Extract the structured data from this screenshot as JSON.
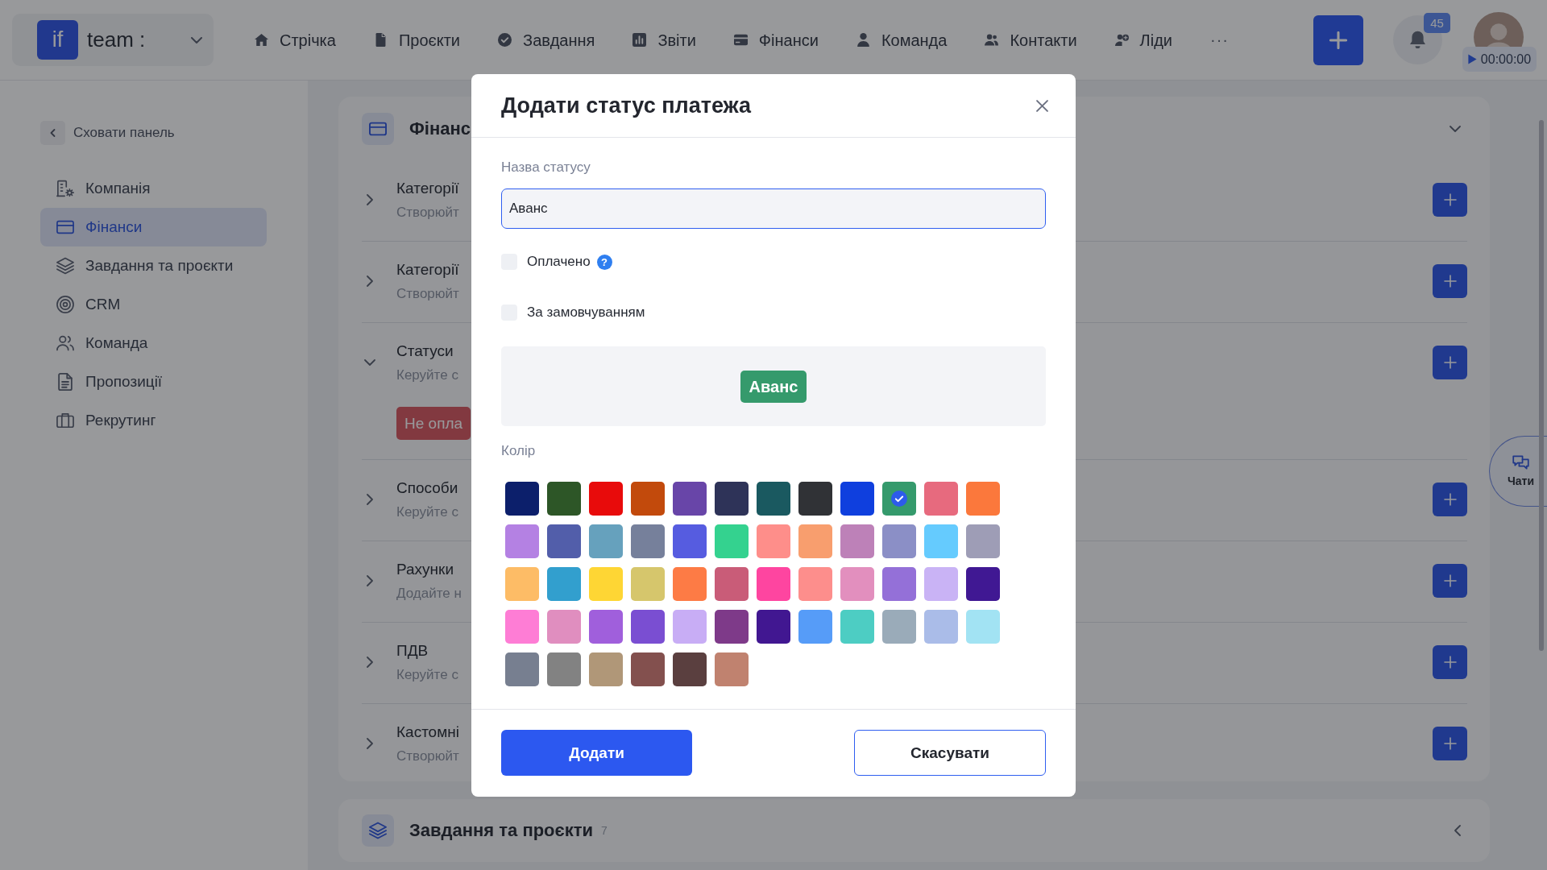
{
  "top_bar": {
    "logo_mark": "if",
    "workspace": "team :",
    "nav": [
      "Стрічка",
      "Проєкти",
      "Завдання",
      "Звіти",
      "Фінанси",
      "Команда",
      "Контакти",
      "Ліди"
    ],
    "more": "···",
    "notifications": "45",
    "timer": "00:00:00"
  },
  "sidebar": {
    "collapse_label": "Сховати панель",
    "items": [
      {
        "label": "Компанія",
        "selected": false
      },
      {
        "label": "Фінанси",
        "selected": true
      },
      {
        "label": "Завдання та проєкти",
        "selected": false
      },
      {
        "label": "CRM",
        "selected": false
      },
      {
        "label": "Команда",
        "selected": false
      },
      {
        "label": "Пропозиції",
        "selected": false
      },
      {
        "label": "Рекрутинг",
        "selected": false
      }
    ]
  },
  "cards": [
    {
      "title": "Фінанс",
      "expanded": true,
      "sections": [
        {
          "title": "Категорії",
          "subtitle": "Створюйт",
          "expanded": false
        },
        {
          "title": "Категорії",
          "subtitle": "Створюйт",
          "expanded": false
        },
        {
          "title": "Статуси",
          "subtitle": "Керуйте с",
          "expanded": true,
          "badges": [
            "Не опла"
          ]
        },
        {
          "title": "Способи",
          "subtitle": "Керуйте с",
          "expanded": false
        },
        {
          "title": "Рахунки",
          "subtitle": "Додайте н",
          "expanded": false
        },
        {
          "title": "ПДВ",
          "subtitle": "Керуйте с",
          "expanded": false
        },
        {
          "title": "Кастомні",
          "subtitle": "Створюйт",
          "expanded": false
        }
      ]
    },
    {
      "title": "Завдання та проєкти",
      "count": "7",
      "expanded": false
    }
  ],
  "chat_tab": {
    "label": "Чати"
  },
  "modal": {
    "title": "Додати статус платежа",
    "name_label": "Назва статусу",
    "name_value": "Аванс",
    "checkboxes": [
      {
        "label": "Оплачено",
        "checked": false,
        "help": "?"
      },
      {
        "label": "За замовчуванням",
        "checked": false
      }
    ],
    "preview": "Аванс",
    "color_label": "Колір",
    "colors": [
      {
        "color": "#0c1f6b",
        "selected": false
      },
      {
        "color": "#2d5627",
        "selected": false
      },
      {
        "color": "#e80b0b",
        "selected": false
      },
      {
        "color": "#c24a0c",
        "selected": false
      },
      {
        "color": "#6845a8",
        "selected": false
      },
      {
        "color": "#2e3358",
        "selected": false
      },
      {
        "color": "#1a5960",
        "selected": false
      },
      {
        "color": "#303236",
        "selected": false
      },
      {
        "color": "#0f3fde",
        "selected": false
      },
      {
        "color": "#359a6c",
        "selected": true
      },
      {
        "color": "#e76a7e",
        "selected": false
      },
      {
        "color": "#fb783c",
        "selected": false
      },
      {
        "color": "#b481e3",
        "selected": false
      },
      {
        "color": "#525eaa",
        "selected": false
      },
      {
        "color": "#66a1bd",
        "selected": false
      },
      {
        "color": "#76809b",
        "selected": false
      },
      {
        "color": "#565ce0",
        "selected": false
      },
      {
        "color": "#34d28f",
        "selected": false
      },
      {
        "color": "#fe8e8a",
        "selected": false
      },
      {
        "color": "#f89e6e",
        "selected": false
      },
      {
        "color": "#bd81b8",
        "selected": false
      },
      {
        "color": "#8b8fc6",
        "selected": false
      },
      {
        "color": "#65cbfe",
        "selected": false
      },
      {
        "color": "#9e9db6",
        "selected": false
      },
      {
        "color": "#fdbc66",
        "selected": false
      },
      {
        "color": "#329fce",
        "selected": false
      },
      {
        "color": "#fed634",
        "selected": false
      },
      {
        "color": "#d6c66c",
        "selected": false
      },
      {
        "color": "#fd7b45",
        "selected": false
      },
      {
        "color": "#c95c78",
        "selected": false
      },
      {
        "color": "#fe45a0",
        "selected": false
      },
      {
        "color": "#fd8e8c",
        "selected": false
      },
      {
        "color": "#e28fbe",
        "selected": false
      },
      {
        "color": "#9470d8",
        "selected": false
      },
      {
        "color": "#c9b3f5",
        "selected": false
      },
      {
        "color": "#401893",
        "selected": false
      },
      {
        "color": "#fe7dd5",
        "selected": false
      },
      {
        "color": "#e08ebf",
        "selected": false
      },
      {
        "color": "#a05fdc",
        "selected": false
      },
      {
        "color": "#7a4ed2",
        "selected": false
      },
      {
        "color": "#c8adf5",
        "selected": false
      },
      {
        "color": "#7e3a89",
        "selected": false
      },
      {
        "color": "#411791",
        "selected": false
      },
      {
        "color": "#569cf8",
        "selected": false
      },
      {
        "color": "#4dcdc3",
        "selected": false
      },
      {
        "color": "#9aabb9",
        "selected": false
      },
      {
        "color": "#aabce8",
        "selected": false
      },
      {
        "color": "#a2e3f3",
        "selected": false
      },
      {
        "color": "#777f90",
        "selected": false
      },
      {
        "color": "#828282",
        "selected": false
      },
      {
        "color": "#b09778",
        "selected": false
      },
      {
        "color": "#83504e",
        "selected": false
      },
      {
        "color": "#5a3f3f",
        "selected": false
      },
      {
        "color": "#c0826f",
        "selected": false
      }
    ],
    "buttons": [
      {
        "label": "Додати",
        "kind": "primary"
      },
      {
        "label": "Скасувати",
        "kind": "secondary"
      }
    ]
  }
}
